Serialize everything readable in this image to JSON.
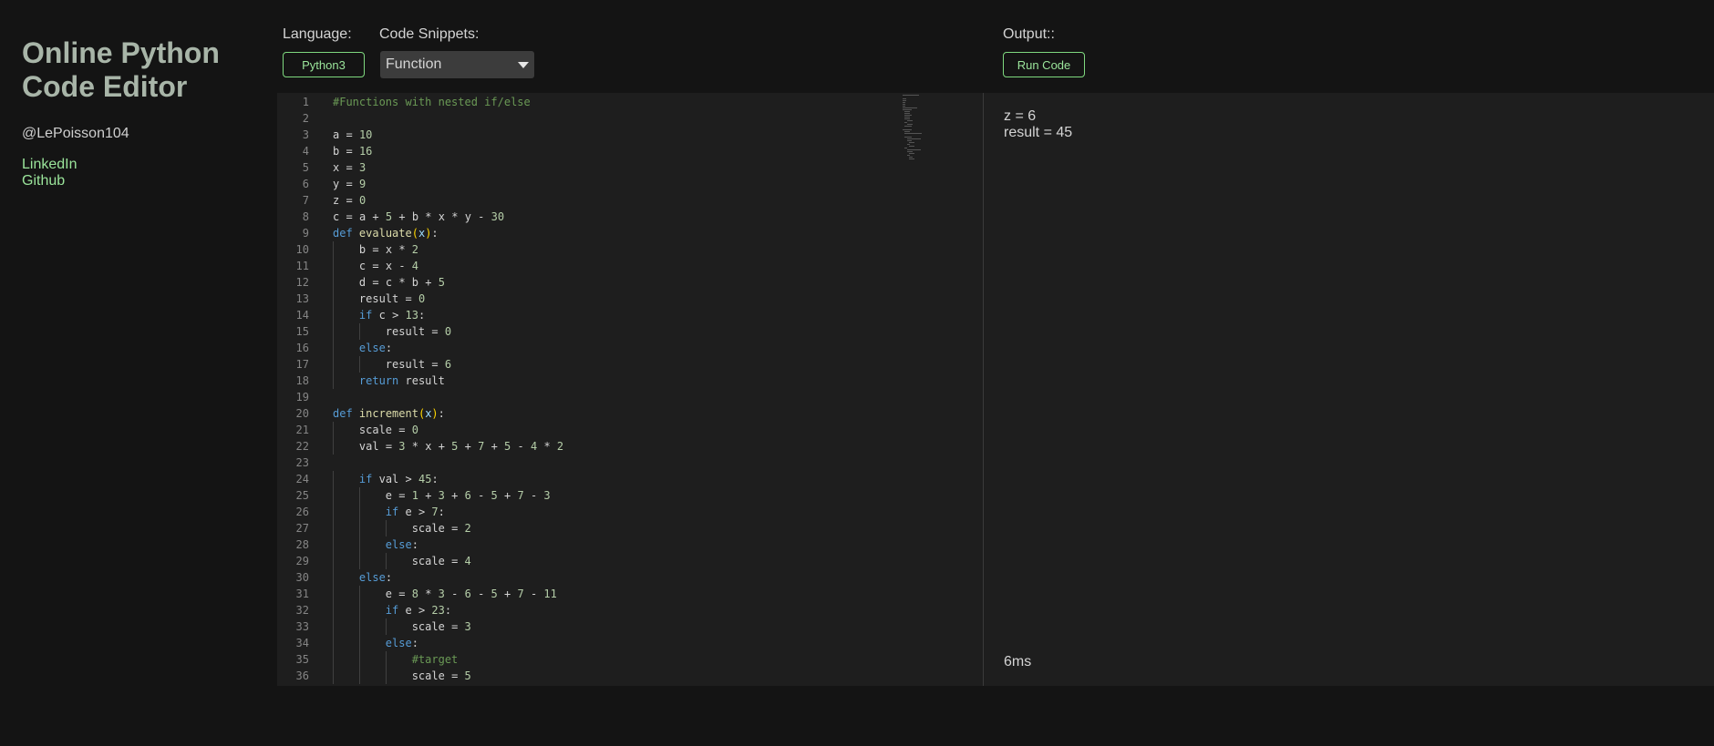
{
  "sidebar": {
    "title": "Online Python Code Editor",
    "handle": "@LePoisson104",
    "links": [
      "LinkedIn",
      "Github"
    ]
  },
  "toolbar": {
    "language_label": "Language:",
    "language_button": "Python3",
    "snippets_label": "Code Snippets:",
    "snippet_selected": "Function",
    "output_label": "Output::",
    "run_button": "Run Code"
  },
  "editor": {
    "lines": [
      "#Functions with nested if/else",
      "",
      "a = 10",
      "b = 16",
      "x = 3",
      "y = 9",
      "z = 0",
      "c = a + 5 + b * x * y - 30",
      "def evaluate(x):",
      "    b = x * 2",
      "    c = x - 4",
      "    d = c * b + 5",
      "    result = 0",
      "    if c > 13:",
      "        result = 0",
      "    else:",
      "        result = 6",
      "    return result",
      "",
      "def increment(x):",
      "    scale = 0",
      "    val = 3 * x + 5 + 7 + 5 - 4 * 2",
      "",
      "    if val > 45:",
      "        e = 1 + 3 + 6 - 5 + 7 - 3",
      "        if e > 7:",
      "            scale = 2",
      "        else:",
      "            scale = 4",
      "    else:",
      "        e = 8 * 3 - 6 - 5 + 7 - 11",
      "        if e > 23:",
      "            scale = 3",
      "        else:",
      "            #target",
      "            scale = 5"
    ]
  },
  "output": {
    "lines": [
      "z = 6",
      "result = 45"
    ],
    "timing": "6ms"
  },
  "colors": {
    "background": "#141414",
    "panel": "#1e1e1e",
    "accent_green": "#9be59b",
    "title": "#a8b5a8"
  }
}
